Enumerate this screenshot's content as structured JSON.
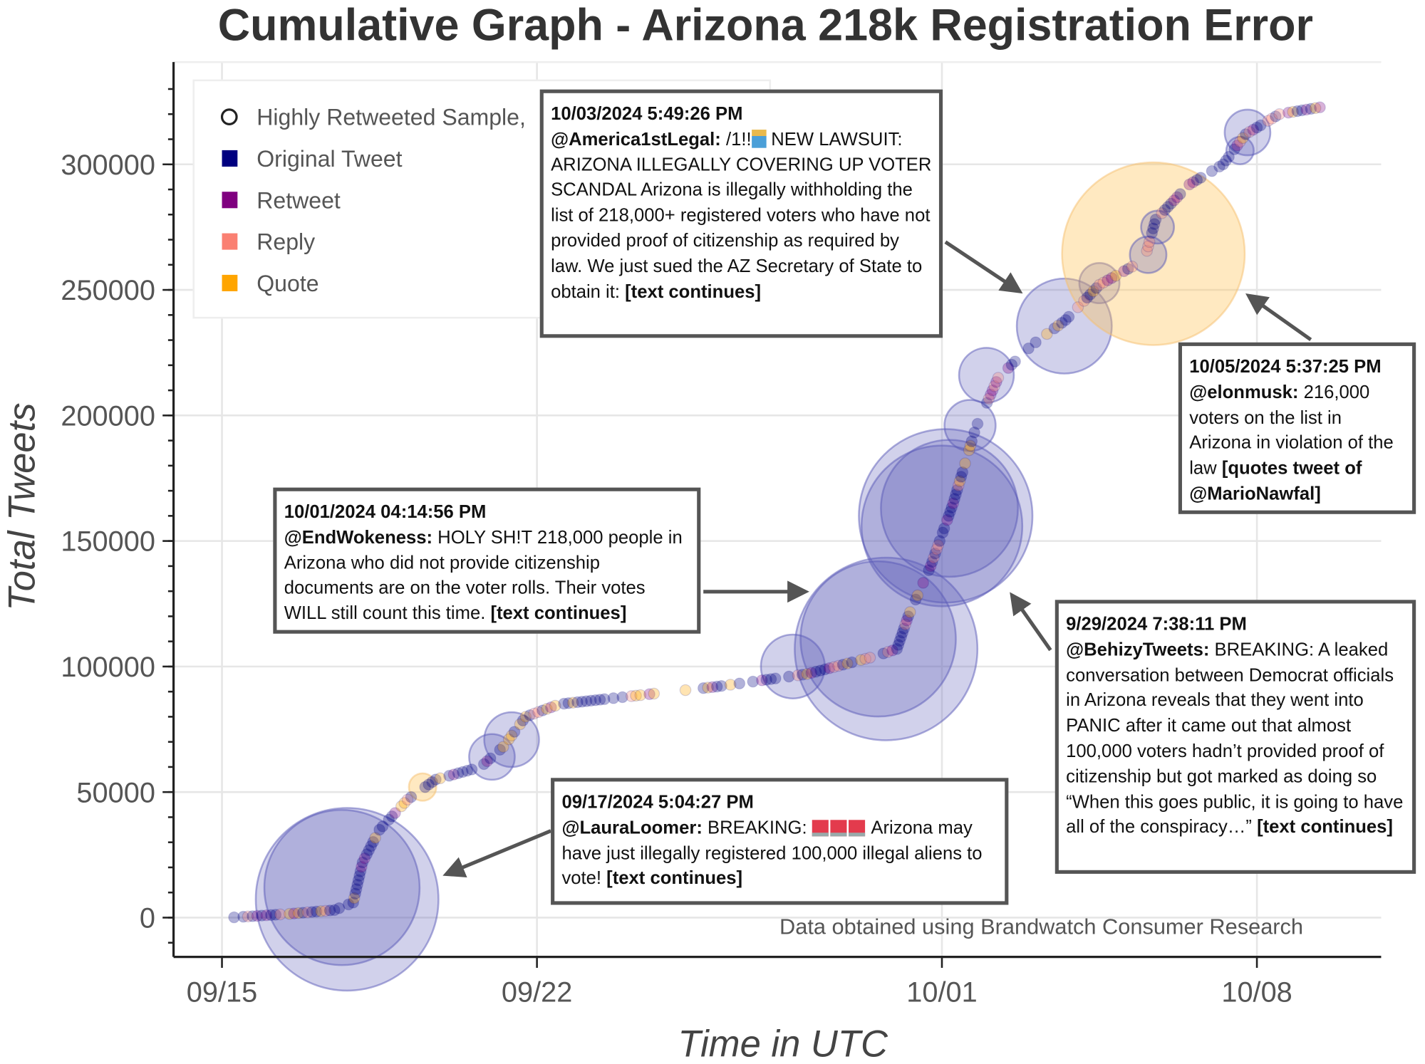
{
  "chart_data": {
    "type": "scatter",
    "title": "Cumulative Graph - Arizona 218k Registration Error",
    "xlabel": "Time in UTC",
    "ylabel": "Total Tweets",
    "source_note": "Data obtained using Brandwatch Consumer Research",
    "xlim": [
      "2024-09-14T00:00",
      "2024-10-11T20:00"
    ],
    "ylim": [
      -15000,
      342000
    ],
    "x_ticks": [
      {
        "label": "09/15",
        "date": "2024-09-15T00:00"
      },
      {
        "label": "09/22",
        "date": "2024-09-22T00:00"
      },
      {
        "label": "10/01",
        "date": "2024-10-01T00:00"
      },
      {
        "label": "10/08",
        "date": "2024-10-08T00:00"
      }
    ],
    "y_ticks": [
      0,
      50000,
      100000,
      150000,
      200000,
      250000,
      300000
    ],
    "y_minor_step": 10000,
    "grid": true,
    "legend": {
      "placement": "top-left",
      "items": [
        {
          "label": "Highly Retweeted Sample,",
          "marker": "open-circle",
          "color": "#222222"
        },
        {
          "label": "Original Tweet",
          "marker": "square",
          "color": "#000080"
        },
        {
          "label": "Retweet",
          "marker": "square",
          "color": "#800080"
        },
        {
          "label": "Reply",
          "marker": "square",
          "color": "#fa8072"
        },
        {
          "label": "Quote",
          "marker": "square",
          "color": "#ffa500"
        }
      ]
    },
    "colors": {
      "original": "#000080",
      "retweet": "#800080",
      "reply": "#fa8072",
      "quote": "#ffa500",
      "sample_fill": "#6a6ac0"
    },
    "cumulative_series": [
      [
        "2024-09-15T04:00",
        0
      ],
      [
        "2024-09-16T12:00",
        1500
      ],
      [
        "2024-09-17T12:00",
        3000
      ],
      [
        "2024-09-17T22:00",
        6000
      ],
      [
        "2024-09-18T03:00",
        22000
      ],
      [
        "2024-09-18T12:00",
        35000
      ],
      [
        "2024-09-19T03:00",
        47000
      ],
      [
        "2024-09-19T18:00",
        55000
      ],
      [
        "2024-09-20T18:00",
        60000
      ],
      [
        "2024-09-21T06:00",
        68000
      ],
      [
        "2024-09-21T18:00",
        80000
      ],
      [
        "2024-09-22T12:00",
        85000
      ],
      [
        "2024-09-24T00:00",
        88000
      ],
      [
        "2024-09-26T00:00",
        92000
      ],
      [
        "2024-09-28T00:00",
        97000
      ],
      [
        "2024-09-29T12:00",
        104000
      ],
      [
        "2024-09-30T00:00",
        107000
      ],
      [
        "2024-09-30T06:00",
        120000
      ],
      [
        "2024-09-30T18:00",
        140000
      ],
      [
        "2024-10-01T06:00",
        165000
      ],
      [
        "2024-10-01T18:00",
        195000
      ],
      [
        "2024-10-02T06:00",
        215000
      ],
      [
        "2024-10-03T00:00",
        228000
      ],
      [
        "2024-10-03T18:00",
        238000
      ],
      [
        "2024-10-04T12:00",
        252000
      ],
      [
        "2024-10-05T12:00",
        262000
      ],
      [
        "2024-10-05T18:00",
        278000
      ],
      [
        "2024-10-06T12:00",
        292000
      ],
      [
        "2024-10-07T06:00",
        300000
      ],
      [
        "2024-10-07T18:00",
        312000
      ],
      [
        "2024-10-08T12:00",
        320000
      ],
      [
        "2024-10-09T12:00",
        323000
      ]
    ],
    "highly_retweeted": [
      {
        "date": "2024-09-17T18:45",
        "value": 7300,
        "type": "original",
        "relative_size": 1.0
      },
      {
        "date": "2024-09-17T16:00",
        "value": 12000,
        "type": "original",
        "relative_size": 0.85
      },
      {
        "date": "2024-09-19T11:00",
        "value": 52000,
        "type": "quote",
        "relative_size": 0.15
      },
      {
        "date": "2024-09-21T10:30",
        "value": 70900,
        "type": "original",
        "relative_size": 0.3
      },
      {
        "date": "2024-09-21T00:00",
        "value": 64000,
        "type": "original",
        "relative_size": 0.25
      },
      {
        "date": "2024-09-27T16:30",
        "value": 100000,
        "type": "original",
        "relative_size": 0.35
      },
      {
        "date": "2024-09-29T18:13",
        "value": 107000,
        "type": "original",
        "relative_size": 1.0
      },
      {
        "date": "2024-09-29T14:00",
        "value": 111000,
        "type": "original",
        "relative_size": 0.85
      },
      {
        "date": "2024-10-01T02:00",
        "value": 160000,
        "type": "original",
        "relative_size": 0.95
      },
      {
        "date": "2024-10-01T00:00",
        "value": 156000,
        "type": "original",
        "relative_size": 0.88
      },
      {
        "date": "2024-10-01T04:00",
        "value": 163000,
        "type": "original",
        "relative_size": 0.75
      },
      {
        "date": "2024-10-01T15:00",
        "value": 196000,
        "type": "original",
        "relative_size": 0.28
      },
      {
        "date": "2024-10-01T23:45",
        "value": 216000,
        "type": "original",
        "relative_size": 0.3
      },
      {
        "date": "2024-10-03T17:16",
        "value": 235600,
        "type": "original",
        "relative_size": 0.52
      },
      {
        "date": "2024-10-04T12:00",
        "value": 252700,
        "type": "original",
        "relative_size": 0.22
      },
      {
        "date": "2024-10-05T16:48",
        "value": 264400,
        "type": "quote",
        "relative_size": 1.0
      },
      {
        "date": "2024-10-05T14:00",
        "value": 264000,
        "type": "original",
        "relative_size": 0.2
      },
      {
        "date": "2024-10-05T19:00",
        "value": 275000,
        "type": "original",
        "relative_size": 0.18
      },
      {
        "date": "2024-10-07T15:00",
        "value": 305500,
        "type": "reply",
        "relative_size": 0.15
      },
      {
        "date": "2024-10-07T19:00",
        "value": 312700,
        "type": "original",
        "relative_size": 0.25
      }
    ],
    "annotations": [
      {
        "timestamp": "10/03/2024 5:49:26 PM",
        "handle": "@America1stLegal:",
        "pre": " /1!!",
        "emoji": "office-worker-emoji",
        "body": " NEW LAWSUIT: ARIZONA ILLEGALLY COVERING UP VOTER SCANDAL Arizona is illegally withholding the list of 218,000+ registered voters who have not provided proof of citizenship as required by law. We just sued the AZ Secretary of State to obtain it: ",
        "suffix": "[text continues]"
      },
      {
        "timestamp": "10/05/2024 5:37:25 PM",
        "handle": "@elonmusk:",
        "pre": " 216,000 voters on the list in Arizona in violation of the law ",
        "emoji": "",
        "body": "",
        "suffix": "[quotes tweet of @MarioNawfal]"
      },
      {
        "timestamp": "10/01/2024 04:14:56 PM",
        "handle": "@EndWokeness:",
        "pre": " HOLY SH!T 218,000 people in Arizona who did not provide citizenship documents are on the voter rolls. Their votes WILL still count this time. ",
        "emoji": "",
        "body": "",
        "suffix": "[text continues]"
      },
      {
        "timestamp": "9/29/2024 7:38:11 PM",
        "handle": "@BehizyTweets:",
        "pre": " BREAKING: A leaked conversation between Democrat officials in Arizona reveals that they went into PANIC after it came out that almost 100,000 voters hadn’t provided proof of citizenship but got marked as doing so “When this goes public, it is going to have all of the conspiracy…” ",
        "emoji": "",
        "body": "",
        "suffix": "[text continues]"
      },
      {
        "timestamp": "09/17/2024 5:04:27 PM",
        "handle": "@LauraLoomer:",
        "pre": " BREAKING: ",
        "emoji": "siren-emoji-x3",
        "body": " Arizona may have just illegally registered 100,000 illegal aliens to vote! ",
        "suffix": "[text continues]"
      }
    ]
  }
}
